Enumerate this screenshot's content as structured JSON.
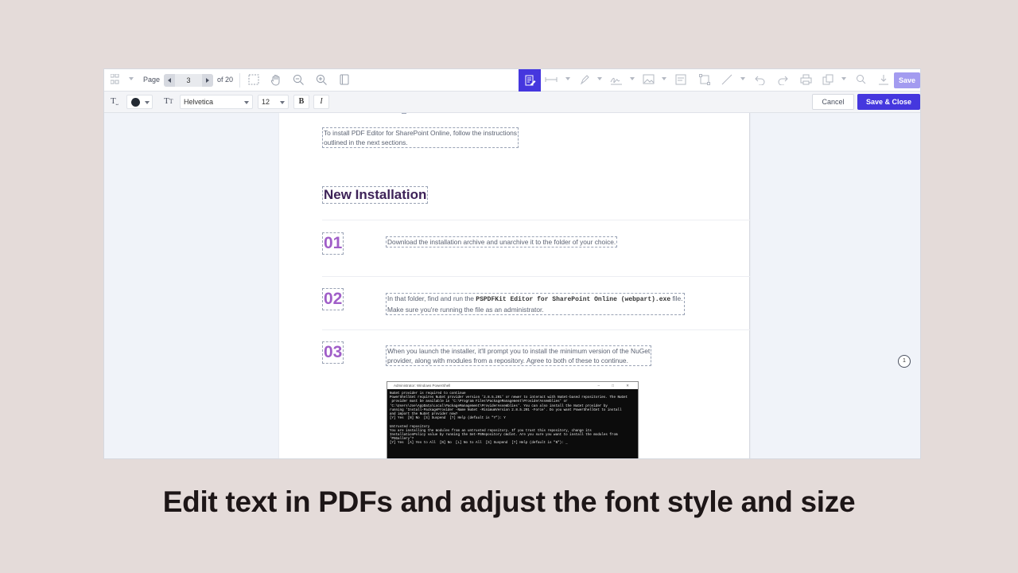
{
  "toolbar": {
    "page_label": "Page",
    "page_value": "3",
    "page_total": "of 20",
    "save_label": "Save"
  },
  "text_toolbar": {
    "font_family": "Helvetica",
    "font_size": "12",
    "bold_label": "B",
    "italic_label": "I",
    "text_color": "#232a33",
    "cancel_label": "Cancel",
    "save_close_label": "Save & Close"
  },
  "document": {
    "intro_line1": "To install PDF Editor for SharePoint Online, follow the instructions",
    "intro_line2": "outlined in the next sections.",
    "heading": "New Installation",
    "steps": [
      {
        "number": "01",
        "line1": "Download the installation archive and unarchive it to the folder of your choice."
      },
      {
        "number": "02",
        "line1_pre": "In that folder, find and run the ",
        "line1_code": "PSPDFKit Editor for SharePoint Online (webpart).exe",
        "line1_post": " file.",
        "line2": "Make sure you're running the file as an administrator."
      },
      {
        "number": "03",
        "line1": "When you launch the installer, it'll prompt you to install the minimum version of the NuGet",
        "line2": "provider, along with modules from a repository. Agree to both of these to continue."
      }
    ],
    "terminal": {
      "title": "Administrator: Windows PowerShell",
      "controls": "– □ ✕",
      "lines": [
        "NuGet provider is required to continue",
        "PowerShellGet requires NuGet provider version '2.8.5.201' or newer to interact with NuGet-based repositories. The NuGet",
        " provider must be available in 'C:\\Program Files\\PackageManagement\\ProviderAssemblies' or",
        "'C:\\Users\\Joe\\AppData\\Local\\PackageManagement\\ProviderAssemblies'. You can also install the NuGet provider by",
        "running 'Install-PackageProvider -Name NuGet -MinimumVersion 2.8.5.201 -Force'. Do you want PowerShellGet to install",
        "and import the NuGet provider now?",
        "[Y] Yes  [N] No  [S] Suspend  [?] Help (default is \"Y\"): Y",
        "",
        "Untrusted repository",
        "You are installing the modules from an untrusted repository. If you trust this repository, change its",
        "InstallationPolicy value by running the Set-PSRepository cmdlet. Are you sure you want to install the modules from",
        "'PSGallery'?",
        "[Y] Yes  [A] Yes to All  [N] No  [L] No to All  [S] Suspend  [?] Help (default is \"N\"): _"
      ]
    }
  },
  "badge": "1",
  "caption": "Edit text in PDFs and adjust the font style and size",
  "colors": {
    "accent": "#4537de",
    "step_number": "#a05ec8",
    "heading": "#3d2258",
    "background": "#e4dbd9"
  }
}
